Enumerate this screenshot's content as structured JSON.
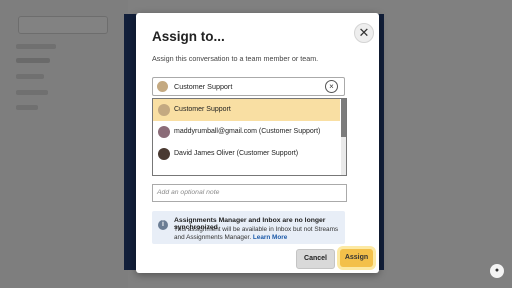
{
  "modal": {
    "title": "Assign to...",
    "subtitle": "Assign this conversation to a team member or team.",
    "search_value": "Customer Support",
    "options": [
      {
        "label": "Customer Support",
        "selected": true
      },
      {
        "label": "maddyrumball@gmail.com (Customer Support)",
        "selected": false
      },
      {
        "label": "David James Oliver (Customer Support)",
        "selected": false
      }
    ],
    "note_placeholder": "Add an optional note",
    "info": {
      "heading": "Assignments Manager and Inbox are no longer synchronized",
      "body": "This assignment will be available in Inbox but not Streams and Assignments Manager.",
      "link": "Learn More"
    },
    "cancel_label": "Cancel",
    "assign_label": "Assign"
  },
  "colors": {
    "selected_row": "#f9dfa3",
    "assign_button": "#f3c04a",
    "info_bg": "#e8eef7",
    "link": "#1d5aa8",
    "background_panel": "#233b6e"
  },
  "icons": {
    "close": "close-icon",
    "clear": "clear-icon",
    "info": "info-icon"
  }
}
